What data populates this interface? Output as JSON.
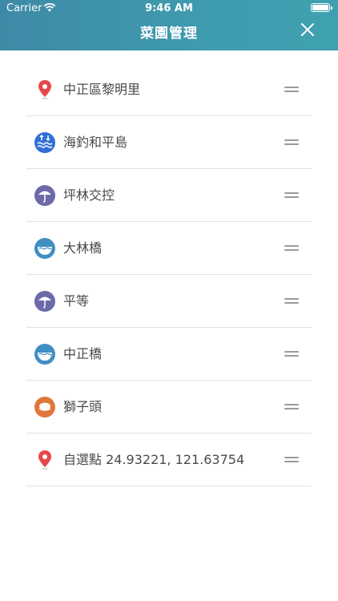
{
  "status": {
    "carrier": "Carrier",
    "time": "9:46 AM"
  },
  "header": {
    "title": "菜園管理"
  },
  "items": [
    {
      "label": "中正區黎明里",
      "icon": "location-pin-icon"
    },
    {
      "label": "海釣和平島",
      "icon": "sea-waves-icon"
    },
    {
      "label": "坪林交控",
      "icon": "umbrella-icon"
    },
    {
      "label": "大林橋",
      "icon": "water-bowl-icon"
    },
    {
      "label": "平等",
      "icon": "umbrella-icon"
    },
    {
      "label": "中正橋",
      "icon": "water-bowl-icon"
    },
    {
      "label": "獅子頭",
      "icon": "fish-cake-icon"
    },
    {
      "label": "自選點 24.93221, 121.63754",
      "icon": "location-pin-icon"
    }
  ],
  "colors": {
    "header_start": "#3e8aa6",
    "header_end": "#3fa1b0",
    "pin_red": "#e5474b",
    "waves_blue": "#2f6fd6",
    "umbrella_purple": "#6c6aa8",
    "bowl_blue": "#3f8fc2",
    "orange": "#e0773a"
  }
}
